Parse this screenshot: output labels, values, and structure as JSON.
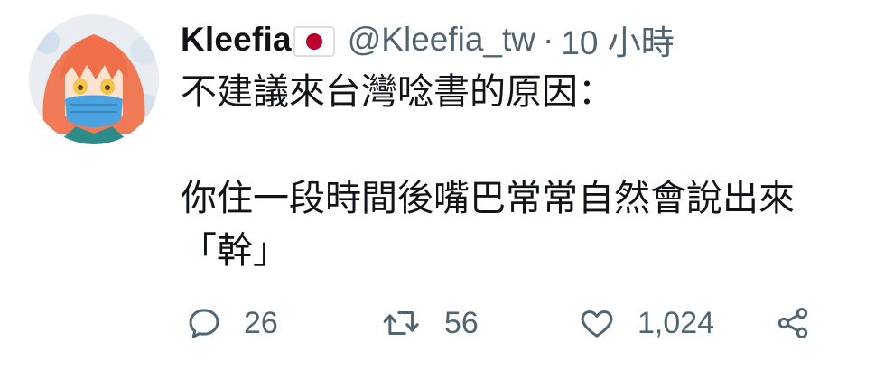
{
  "tweet": {
    "author": {
      "display_name": "Kleefia",
      "flag_icon": "japan-flag-icon",
      "handle": "@Kleefia_tw",
      "separator": "·",
      "time": "10 小時"
    },
    "text": {
      "line1": "不建議來台灣唸書的原因：",
      "line2": "你住一段時間後嘴巴常常自然會說出來",
      "line3": "「幹」"
    },
    "actions": {
      "reply": {
        "icon": "reply-icon",
        "count": "26"
      },
      "retweet": {
        "icon": "retweet-icon",
        "count": "56"
      },
      "like": {
        "icon": "heart-icon",
        "count": "1,024"
      },
      "share": {
        "icon": "share-icon"
      }
    },
    "colors": {
      "text": "#0f1419",
      "secondary": "#536471",
      "flag_red": "#bc002d"
    }
  }
}
